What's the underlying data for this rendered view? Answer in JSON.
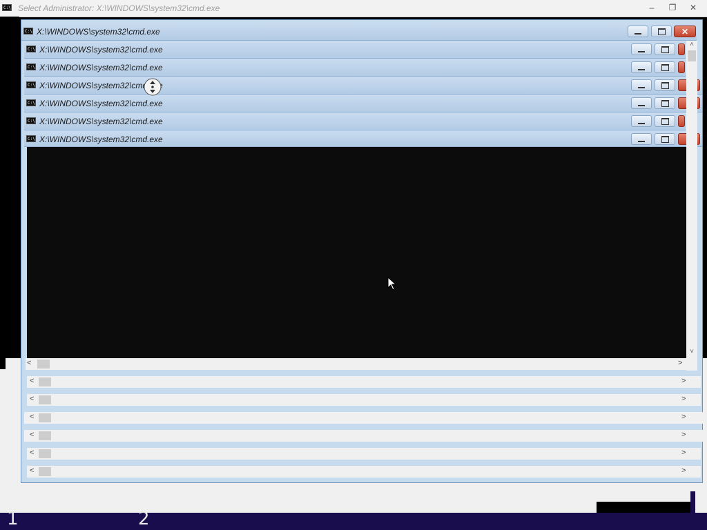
{
  "root_window": {
    "title": "Select Administrator: X:\\WINDOWS\\system32\\cmd.exe",
    "buttons": [
      "minimize",
      "restore",
      "close"
    ]
  },
  "cmd_windows": [
    {
      "title": "X:\\WINDOWS\\system32\\cmd.exe",
      "close_style": "full"
    },
    {
      "title": "X:\\WINDOWS\\system32\\cmd.exe",
      "close_style": "partial"
    },
    {
      "title": "X:\\WINDOWS\\system32\\cmd.exe",
      "close_style": "partial"
    },
    {
      "title": "X:\\WINDOWS\\system32\\cmd.exe",
      "close_style": "full"
    },
    {
      "title": "X:\\WINDOWS\\system32\\cmd.exe",
      "close_style": "full"
    },
    {
      "title": "X:\\WINDOWS\\system32\\cmd.exe",
      "close_style": "partial"
    },
    {
      "title": "X:\\WINDOWS\\system32\\cmd.exe",
      "close_style": "full"
    }
  ],
  "scrollbars": {
    "left_arrow": "<",
    "right_arrow": ">",
    "up_arrow": "˄",
    "down_arrow": "˅"
  },
  "taskbar": {
    "items": [
      "1",
      "2"
    ]
  },
  "icons": {
    "cmd": "cmd-icon",
    "cursor": "mouse-pointer-icon",
    "drag": "scroll-drag-icon"
  },
  "colors": {
    "console_bg": "#0c0c0c",
    "title_bar": "#b3cbe5",
    "close_button": "#c6432c",
    "taskbar": "#1a0d4d"
  }
}
